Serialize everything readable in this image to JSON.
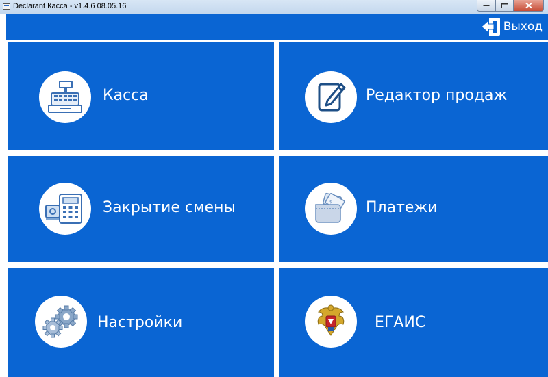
{
  "window": {
    "title": "Declarant Касса - v1.4.6 08.05.16"
  },
  "header": {
    "exit_label": "Выход",
    "exit_icon": "exit-door-icon"
  },
  "tiles": [
    {
      "id": "kassa",
      "label": "Касса",
      "icon": "cash-register-icon"
    },
    {
      "id": "sales-editor",
      "label": "Редактор продаж",
      "icon": "pencil-edit-icon"
    },
    {
      "id": "close-shift",
      "label": "Закрытие смены",
      "icon": "calculator-icon"
    },
    {
      "id": "payments",
      "label": "Платежи",
      "icon": "wallet-icon"
    },
    {
      "id": "settings",
      "label": "Настройки",
      "icon": "gears-icon"
    },
    {
      "id": "egais",
      "label": "ЕГАИС",
      "icon": "coat-of-arms-icon"
    }
  ],
  "colors": {
    "tile_blue": "#0a65d3",
    "background": "#ffffff",
    "text": "#ffffff"
  }
}
